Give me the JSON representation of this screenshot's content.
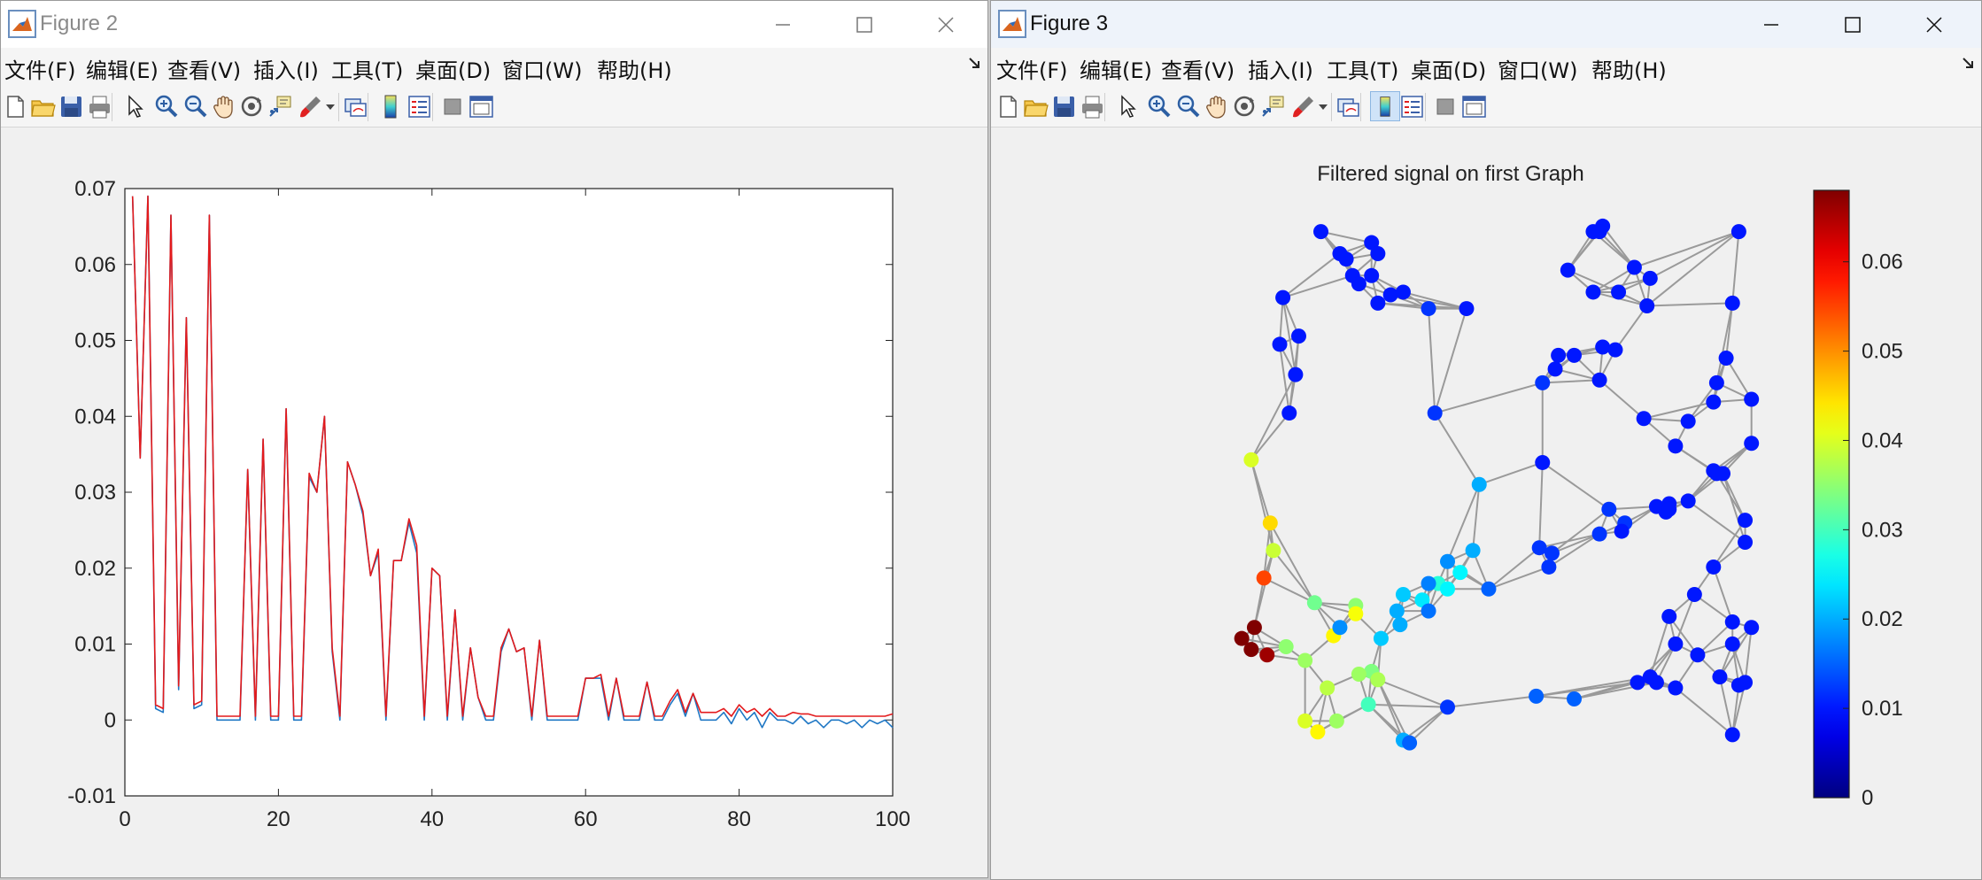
{
  "figure2": {
    "title": "Figure 2",
    "menu": [
      "文件(F)",
      "编辑(E)",
      "查看(V)",
      "插入(I)",
      "工具(T)",
      "桌面(D)",
      "窗口(W)",
      "帮助(H)"
    ],
    "toolbar_icons": [
      "new-file-icon",
      "open-folder-icon",
      "save-icon",
      "print-icon",
      "select-arrow-icon",
      "zoom-in-icon",
      "zoom-out-icon",
      "pan-hand-icon",
      "rotate-3d-icon",
      "data-cursor-icon",
      "brush-icon",
      "brush-dropdown-icon",
      "link-plot-icon",
      "insert-colorbar-icon",
      "insert-legend-icon",
      "hide-plot-tools-icon",
      "show-plot-tools-icon"
    ]
  },
  "figure3": {
    "title": "Figure 3",
    "menu": [
      "文件(F)",
      "编辑(E)",
      "查看(V)",
      "插入(I)",
      "工具(T)",
      "桌面(D)",
      "窗口(W)",
      "帮助(H)"
    ]
  },
  "colors": {
    "red_series": "#e31a1c",
    "blue_series": "#1f77c4",
    "edge": "#9a9a9a"
  },
  "chart_data": [
    {
      "type": "line",
      "title": "",
      "xlabel": "",
      "ylabel": "",
      "xlim": [
        0,
        100
      ],
      "ylim": [
        -0.01,
        0.07
      ],
      "xticks": [
        "0",
        "20",
        "40",
        "60",
        "80",
        "100"
      ],
      "yticks": [
        "-0.01",
        "0",
        "0.01",
        "0.02",
        "0.03",
        "0.04",
        "0.05",
        "0.06",
        "0.07"
      ],
      "grid": false,
      "x": [
        1,
        2,
        3,
        4,
        5,
        6,
        7,
        8,
        9,
        10,
        11,
        12,
        13,
        14,
        15,
        16,
        17,
        18,
        19,
        20,
        21,
        22,
        23,
        24,
        25,
        26,
        27,
        28,
        29,
        30,
        31,
        32,
        33,
        34,
        35,
        36,
        37,
        38,
        39,
        40,
        41,
        42,
        43,
        44,
        45,
        46,
        47,
        48,
        49,
        50,
        51,
        52,
        53,
        54,
        55,
        56,
        57,
        58,
        59,
        60,
        61,
        62,
        63,
        64,
        65,
        66,
        67,
        68,
        69,
        70,
        71,
        72,
        73,
        74,
        75,
        76,
        77,
        78,
        79,
        80,
        81,
        82,
        83,
        84,
        85,
        86,
        87,
        88,
        89,
        90,
        91,
        92,
        93,
        94,
        95,
        96,
        97,
        98,
        99,
        100
      ],
      "series": [
        {
          "color": "#1f77c4",
          "values": [
            0.069,
            0.0345,
            0.069,
            0.0015,
            0.001,
            0.0665,
            0.004,
            0.053,
            0.0015,
            0.002,
            0.0665,
            0.0,
            0.0,
            0.0,
            0.0,
            0.033,
            0.0,
            0.037,
            0.0,
            0.0,
            0.041,
            0.0,
            0.0,
            0.032,
            0.03,
            0.04,
            0.009,
            0.0,
            0.034,
            0.031,
            0.027,
            0.019,
            0.022,
            0.0,
            0.021,
            0.021,
            0.026,
            0.022,
            0.0,
            0.02,
            0.019,
            0.0,
            0.0145,
            0.0,
            0.0095,
            0.003,
            0.0,
            0.0,
            0.009,
            0.012,
            0.009,
            0.0095,
            0.0,
            0.0105,
            0.0,
            0.0,
            0.0,
            0.0,
            0.0,
            0.0055,
            0.0055,
            0.0055,
            0.0,
            0.0055,
            0.0,
            0.0,
            0.0,
            0.005,
            0.0,
            0.0,
            0.002,
            0.0035,
            0.0005,
            0.0035,
            0.0,
            0.0,
            0.0,
            0.001,
            -0.0005,
            0.0015,
            0.0,
            0.001,
            -0.001,
            0.001,
            0.0,
            0.0,
            -0.0005,
            0.0005,
            -0.0005,
            0.0,
            -0.001,
            0.0,
            0.0,
            -0.0005,
            0.0,
            -0.001,
            0.0,
            -0.0005,
            0.0,
            -0.001
          ]
        },
        {
          "color": "#e31a1c",
          "values": [
            0.069,
            0.0345,
            0.069,
            0.002,
            0.0015,
            0.0665,
            0.0045,
            0.053,
            0.002,
            0.0025,
            0.0665,
            0.0005,
            0.0005,
            0.0005,
            0.0005,
            0.033,
            0.0005,
            0.037,
            0.0005,
            0.0005,
            0.041,
            0.0005,
            0.0005,
            0.0325,
            0.03,
            0.04,
            0.0095,
            0.0005,
            0.034,
            0.031,
            0.0275,
            0.019,
            0.0225,
            0.0005,
            0.021,
            0.021,
            0.0265,
            0.023,
            0.0005,
            0.02,
            0.019,
            0.0005,
            0.0145,
            0.0005,
            0.0095,
            0.003,
            0.0005,
            0.0005,
            0.0095,
            0.012,
            0.009,
            0.0095,
            0.0005,
            0.0105,
            0.0005,
            0.0005,
            0.0005,
            0.0005,
            0.0005,
            0.0055,
            0.0055,
            0.006,
            0.0005,
            0.0055,
            0.0005,
            0.0005,
            0.0005,
            0.005,
            0.0005,
            0.0005,
            0.0025,
            0.004,
            0.001,
            0.0035,
            0.001,
            0.001,
            0.001,
            0.0015,
            0.0005,
            0.002,
            0.001,
            0.0015,
            0.0005,
            0.0015,
            0.0005,
            0.0005,
            0.001,
            0.0008,
            0.0008,
            0.0005,
            0.0005,
            0.0005,
            0.0005,
            0.0005,
            0.0005,
            0.0005,
            0.0005,
            0.0005,
            0.0005,
            0.0008
          ]
        }
      ]
    },
    {
      "type": "scatter",
      "title": "Filtered signal on first Graph",
      "colorbar": {
        "colormap": "jet",
        "limits": [
          0,
          0.068
        ],
        "ticks": [
          "0",
          "0.01",
          "0.02",
          "0.03",
          "0.04",
          "0.05",
          "0.06"
        ],
        "tick_values": [
          0,
          0.01,
          0.02,
          0.03,
          0.04,
          0.05,
          0.06
        ]
      },
      "nodes": [
        [
          0.01,
          0.3,
          0.97
        ],
        [
          0.01,
          0.33,
          0.93
        ],
        [
          0.01,
          0.38,
          0.95
        ],
        [
          0.01,
          0.34,
          0.92
        ],
        [
          0.01,
          0.39,
          0.93
        ],
        [
          0.01,
          0.35,
          0.89
        ],
        [
          0.01,
          0.38,
          0.89
        ],
        [
          0.01,
          0.36,
          0.875
        ],
        [
          0.01,
          0.41,
          0.855
        ],
        [
          0.01,
          0.43,
          0.86
        ],
        [
          0.01,
          0.39,
          0.84
        ],
        [
          0.01,
          0.24,
          0.85
        ],
        [
          0.01,
          0.265,
          0.78
        ],
        [
          0.01,
          0.235,
          0.765
        ],
        [
          0.01,
          0.26,
          0.71
        ],
        [
          0.01,
          0.25,
          0.64
        ],
        [
          0.012,
          0.47,
          0.83
        ],
        [
          0.01,
          0.53,
          0.83
        ],
        [
          0.012,
          0.48,
          0.64
        ],
        [
          0.02,
          0.55,
          0.51
        ],
        [
          0.04,
          0.19,
          0.555
        ],
        [
          0.01,
          0.73,
          0.97
        ],
        [
          0.01,
          0.745,
          0.98
        ],
        [
          0.01,
          0.74,
          0.97
        ],
        [
          0.01,
          0.69,
          0.9
        ],
        [
          0.01,
          0.795,
          0.905
        ],
        [
          0.01,
          0.82,
          0.885
        ],
        [
          0.01,
          0.73,
          0.86
        ],
        [
          0.01,
          0.77,
          0.86
        ],
        [
          0.01,
          0.815,
          0.835
        ],
        [
          0.01,
          0.675,
          0.745
        ],
        [
          0.01,
          0.7,
          0.745
        ],
        [
          0.01,
          0.745,
          0.76
        ],
        [
          0.01,
          0.765,
          0.755
        ],
        [
          0.01,
          0.67,
          0.72
        ],
        [
          0.01,
          0.74,
          0.7
        ],
        [
          0.01,
          0.81,
          0.63
        ],
        [
          0.012,
          0.65,
          0.695
        ],
        [
          0.01,
          0.65,
          0.55
        ],
        [
          0.01,
          0.96,
          0.97
        ],
        [
          0.01,
          0.95,
          0.84
        ],
        [
          0.01,
          0.94,
          0.74
        ],
        [
          0.01,
          0.925,
          0.695
        ],
        [
          0.01,
          0.92,
          0.66
        ],
        [
          0.01,
          0.98,
          0.665
        ],
        [
          0.01,
          0.88,
          0.625
        ],
        [
          0.01,
          0.98,
          0.585
        ],
        [
          0.01,
          0.86,
          0.58
        ],
        [
          0.01,
          0.92,
          0.535
        ],
        [
          0.01,
          0.925,
          0.53
        ],
        [
          0.01,
          0.935,
          0.53
        ],
        [
          0.01,
          0.97,
          0.445
        ],
        [
          0.01,
          0.88,
          0.48
        ],
        [
          0.01,
          0.85,
          0.475
        ],
        [
          0.01,
          0.97,
          0.405
        ],
        [
          0.012,
          0.755,
          0.465
        ],
        [
          0.01,
          0.83,
          0.47
        ],
        [
          0.01,
          0.845,
          0.46
        ],
        [
          0.01,
          0.85,
          0.465
        ],
        [
          0.012,
          0.78,
          0.44
        ],
        [
          0.01,
          0.775,
          0.425
        ],
        [
          0.012,
          0.74,
          0.42
        ],
        [
          0.012,
          0.645,
          0.395
        ],
        [
          0.012,
          0.665,
          0.385
        ],
        [
          0.012,
          0.66,
          0.36
        ],
        [
          0.01,
          0.92,
          0.36
        ],
        [
          0.01,
          0.89,
          0.31
        ],
        [
          0.01,
          0.95,
          0.26
        ],
        [
          0.01,
          0.98,
          0.25
        ],
        [
          0.01,
          0.85,
          0.27
        ],
        [
          0.01,
          0.86,
          0.22
        ],
        [
          0.01,
          0.895,
          0.2
        ],
        [
          0.01,
          0.95,
          0.22
        ],
        [
          0.01,
          0.93,
          0.16
        ],
        [
          0.01,
          0.86,
          0.14
        ],
        [
          0.01,
          0.83,
          0.15
        ],
        [
          0.01,
          0.8,
          0.15
        ],
        [
          0.01,
          0.82,
          0.16
        ],
        [
          0.01,
          0.96,
          0.145
        ],
        [
          0.01,
          0.97,
          0.15
        ],
        [
          0.01,
          0.95,
          0.055
        ],
        [
          0.015,
          0.7,
          0.12
        ],
        [
          0.015,
          0.64,
          0.125
        ],
        [
          0.02,
          0.54,
          0.39
        ],
        [
          0.025,
          0.52,
          0.35
        ],
        [
          0.028,
          0.485,
          0.33
        ],
        [
          0.025,
          0.5,
          0.32
        ],
        [
          0.022,
          0.43,
          0.31
        ],
        [
          0.02,
          0.42,
          0.28
        ],
        [
          0.02,
          0.425,
          0.255
        ],
        [
          0.018,
          0.5,
          0.37
        ],
        [
          0.024,
          0.46,
          0.3
        ],
        [
          0.035,
          0.355,
          0.29
        ],
        [
          0.033,
          0.29,
          0.295
        ],
        [
          0.035,
          0.245,
          0.215
        ],
        [
          0.036,
          0.275,
          0.19
        ],
        [
          0.034,
          0.38,
          0.17
        ],
        [
          0.038,
          0.31,
          0.14
        ],
        [
          0.036,
          0.36,
          0.165
        ],
        [
          0.022,
          0.395,
          0.23
        ],
        [
          0.016,
          0.47,
          0.28
        ],
        [
          0.017,
          0.47,
          0.33
        ],
        [
          0.039,
          0.225,
          0.39
        ],
        [
          0.037,
          0.39,
          0.155
        ],
        [
          0.045,
          0.22,
          0.44
        ],
        [
          0.055,
          0.21,
          0.34
        ],
        [
          0.04,
          0.275,
          0.08
        ],
        [
          0.036,
          0.325,
          0.08
        ],
        [
          0.03,
          0.375,
          0.11
        ],
        [
          0.042,
          0.355,
          0.275
        ],
        [
          0.043,
          0.32,
          0.235
        ],
        [
          0.043,
          0.295,
          0.06
        ],
        [
          0.068,
          0.19,
          0.21
        ],
        [
          0.068,
          0.195,
          0.25
        ],
        [
          0.068,
          0.175,
          0.23
        ],
        [
          0.066,
          0.215,
          0.2
        ],
        [
          0.02,
          0.43,
          0.045
        ],
        [
          0.015,
          0.44,
          0.04
        ],
        [
          0.012,
          0.5,
          0.105
        ],
        [
          0.015,
          0.565,
          0.32
        ],
        [
          0.018,
          0.33,
          0.25
        ]
      ]
    }
  ]
}
